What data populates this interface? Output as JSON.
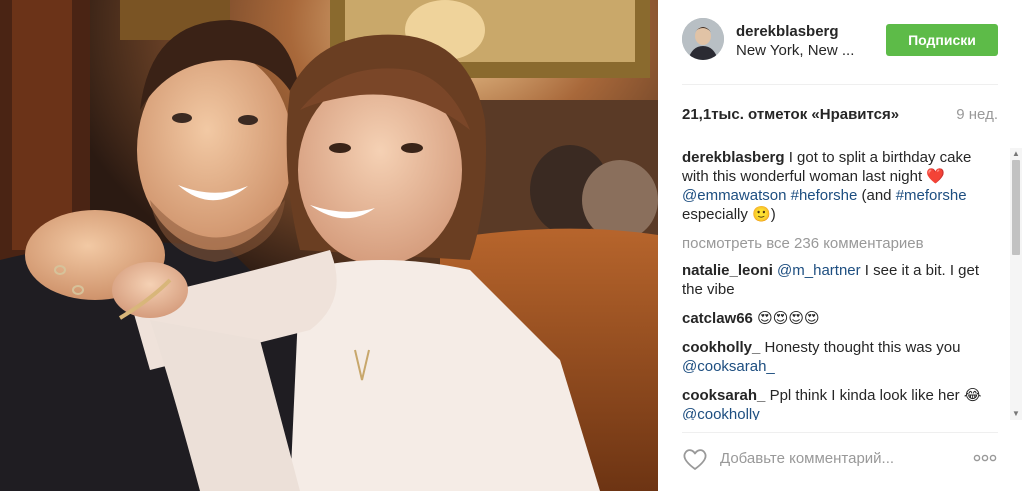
{
  "post": {
    "image_alt": "Photo"
  },
  "header": {
    "username": "derekblasberg",
    "location": "New York, New ...",
    "follow_label": "Подписки"
  },
  "stats": {
    "likes": "21,1тыс. отметок «Нравится»",
    "age": "9 нед."
  },
  "caption": {
    "user": "derekblasberg",
    "text_before": "I got to split a birthday cake with this wonderful woman last night ❤️ ",
    "mention": "@emmawatson",
    "hashtag1": "#heforshe",
    "text_middle": " (and ",
    "hashtag2": "#meforshe",
    "text_after": " especially 🙂)"
  },
  "view_all": "посмотреть все 236 комментариев",
  "comments": [
    {
      "user": "natalie_leoni",
      "mention": "@m_hartner",
      "text": " I see it a bit. I get the vibe"
    },
    {
      "user": "catclaw66",
      "mention": "",
      "text": "😍😍😍😍"
    },
    {
      "user": "cookholly_",
      "mention": "",
      "text": "Honesty thought this was you ",
      "mention_after": "@cooksarah_"
    },
    {
      "user": "cooksarah_",
      "mention": "",
      "text": "Ppl think I kinda look like her 😂 ",
      "mention_after": "@cookholly_"
    }
  ],
  "add_comment": {
    "placeholder": "Добавьте комментарий..."
  },
  "icons": {
    "like": "heart-icon",
    "more": "more-options-icon",
    "avatar": "avatar"
  },
  "colors": {
    "follow_button": "#5dbb48",
    "link": "#1d4e80",
    "muted": "#999999"
  }
}
